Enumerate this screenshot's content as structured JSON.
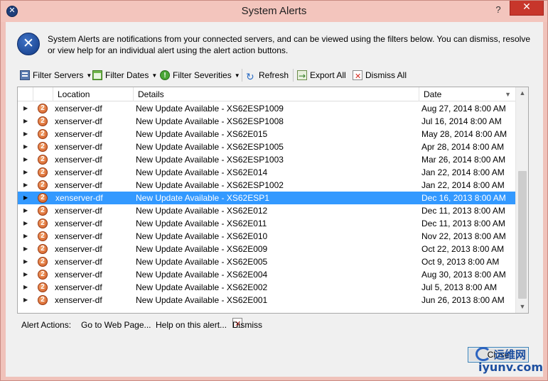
{
  "window": {
    "title": "System Alerts",
    "help_label": "?",
    "close_label": "✕"
  },
  "info": {
    "text": "System Alerts are notifications from your connected servers, and can be viewed using the filters below. You can dismiss, resolve or view help for an individual alert using the alert action buttons."
  },
  "toolbar": {
    "filter_servers": "Filter Servers",
    "filter_dates": "Filter Dates",
    "filter_severities": "Filter Severities",
    "refresh": "Refresh",
    "export_all": "Export All",
    "dismiss_all": "Dismiss All"
  },
  "grid": {
    "columns": {
      "location": "Location",
      "details": "Details",
      "date": "Date"
    },
    "selected_index": 7,
    "rows": [
      {
        "location": "xenserver-df",
        "details": "New Update Available - XS62ESP1009",
        "date": "Aug 27, 2014 8:00 AM"
      },
      {
        "location": "xenserver-df",
        "details": "New Update Available - XS62ESP1008",
        "date": "Jul 16, 2014 8:00 AM"
      },
      {
        "location": "xenserver-df",
        "details": "New Update Available - XS62E015",
        "date": "May 28, 2014 8:00 AM"
      },
      {
        "location": "xenserver-df",
        "details": "New Update Available - XS62ESP1005",
        "date": "Apr 28, 2014 8:00 AM"
      },
      {
        "location": "xenserver-df",
        "details": "New Update Available - XS62ESP1003",
        "date": "Mar 26, 2014 8:00 AM"
      },
      {
        "location": "xenserver-df",
        "details": "New Update Available - XS62E014",
        "date": "Jan 22, 2014 8:00 AM"
      },
      {
        "location": "xenserver-df",
        "details": "New Update Available - XS62ESP1002",
        "date": "Jan 22, 2014 8:00 AM"
      },
      {
        "location": "xenserver-df",
        "details": "New Update Available - XS62ESP1",
        "date": "Dec 16, 2013 8:00 AM"
      },
      {
        "location": "xenserver-df",
        "details": "New Update Available - XS62E012",
        "date": "Dec 11, 2013 8:00 AM"
      },
      {
        "location": "xenserver-df",
        "details": "New Update Available - XS62E011",
        "date": "Dec 11, 2013 8:00 AM"
      },
      {
        "location": "xenserver-df",
        "details": "New Update Available - XS62E010",
        "date": "Nov 22, 2013 8:00 AM"
      },
      {
        "location": "xenserver-df",
        "details": "New Update Available - XS62E009",
        "date": "Oct 22, 2013 8:00 AM"
      },
      {
        "location": "xenserver-df",
        "details": "New Update Available - XS62E005",
        "date": "Oct 9, 2013 8:00 AM"
      },
      {
        "location": "xenserver-df",
        "details": "New Update Available - XS62E004",
        "date": "Aug 30, 2013 8:00 AM"
      },
      {
        "location": "xenserver-df",
        "details": "New Update Available - XS62E002",
        "date": "Jul 5, 2013 8:00 AM"
      },
      {
        "location": "xenserver-df",
        "details": "New Update Available - XS62E001",
        "date": "Jun 26, 2013 8:00 AM"
      }
    ]
  },
  "actions": {
    "label": "Alert Actions:",
    "go_to_web_page": "Go to Web Page...",
    "help_on_alert": "Help on this alert...",
    "dismiss": "Dismiss"
  },
  "footer": {
    "close_button": "Close"
  },
  "watermark": {
    "cn": "运维网",
    "en": "iyunv.com"
  },
  "colors": {
    "title_bg": "#f3c5bd",
    "close_btn": "#c7362b",
    "selection": "#3399ff"
  }
}
